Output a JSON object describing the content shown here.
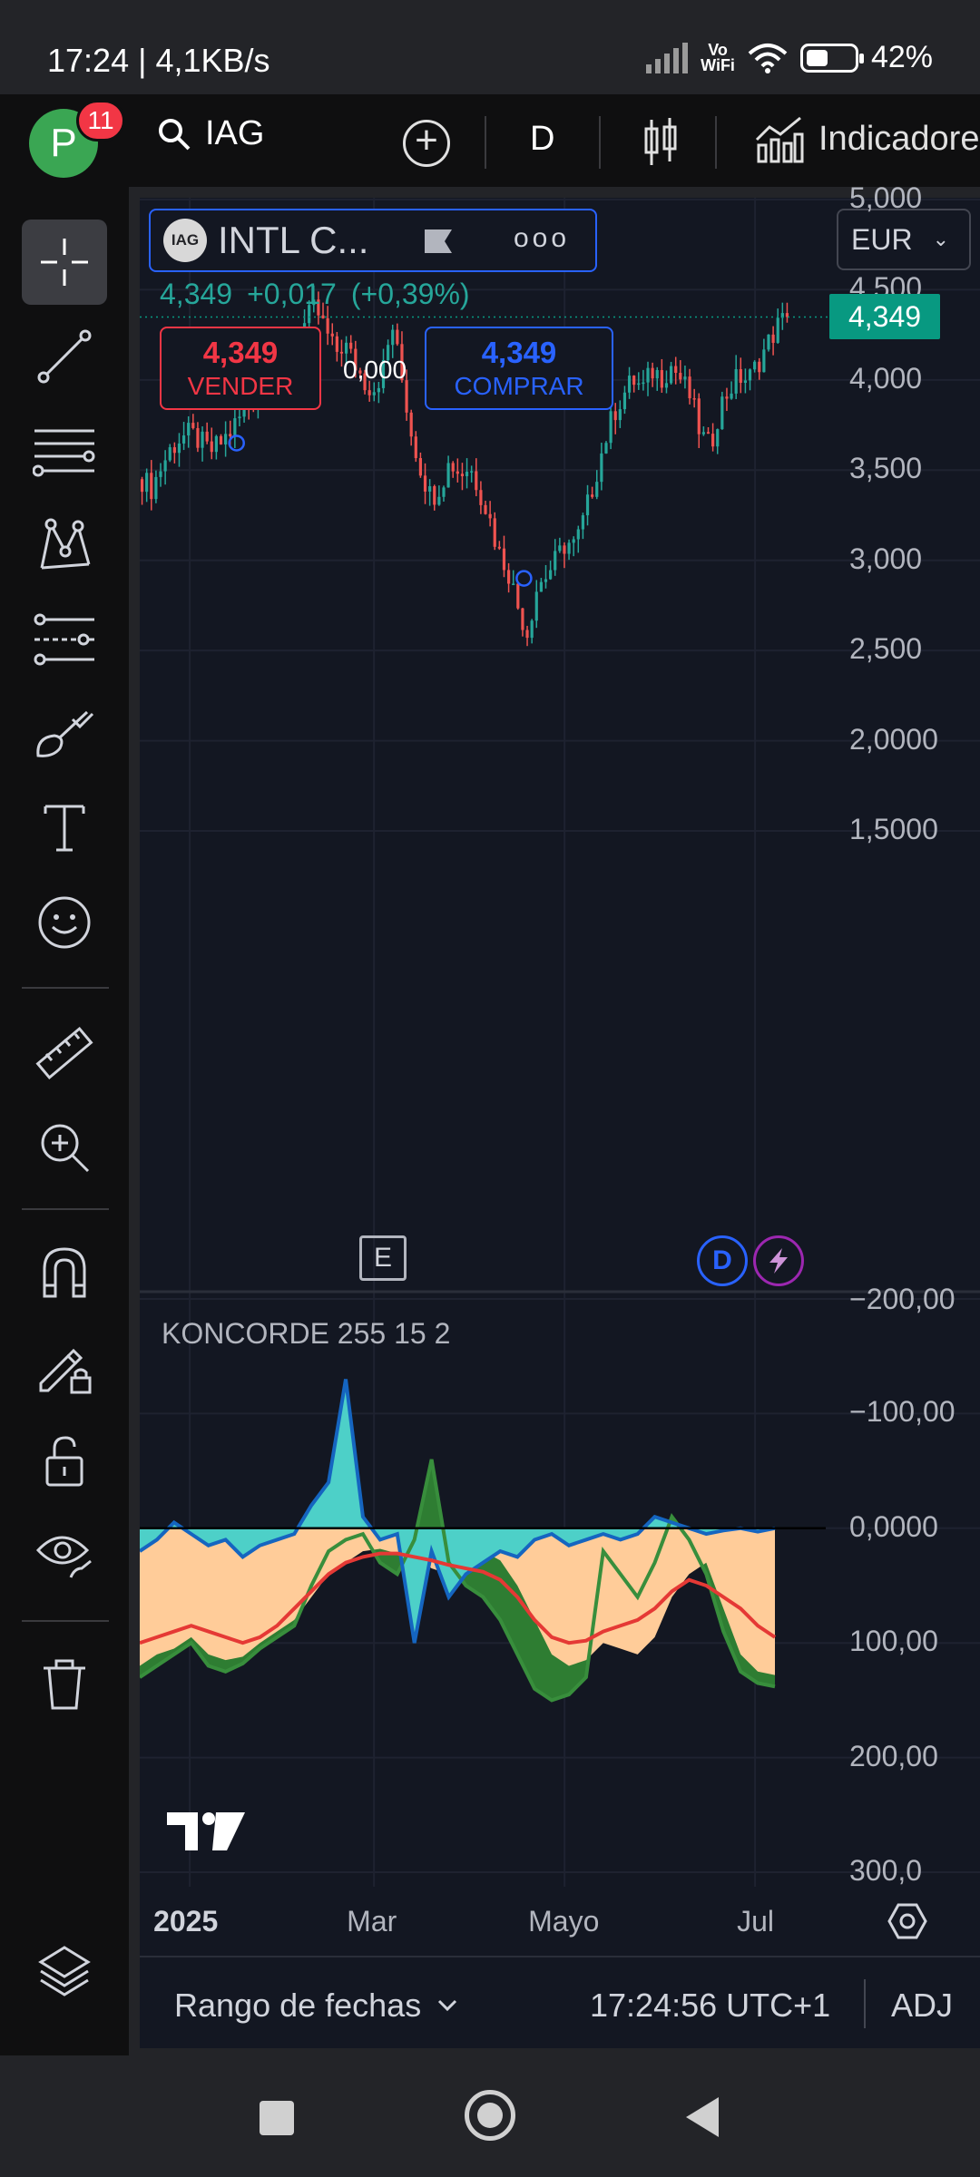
{
  "status_bar": {
    "time": "17:24 | 4,1KB/s",
    "network": "Vo\nWiFi",
    "battery": "42%"
  },
  "toolbar": {
    "notification_count": "11",
    "avatar_letter": "P",
    "symbol": "IAG",
    "interval": "D",
    "indicators_label": "Indicadores"
  },
  "symbol_box": {
    "logo_text": "IAG",
    "name": "INTL C...",
    "more": "ooo"
  },
  "currency": "EUR",
  "quote": {
    "last": "4,349",
    "change": "+0,017",
    "change_pct": "(+0,39%)",
    "sell_price": "4,349",
    "sell_label": "VENDER",
    "spread": "0,000",
    "buy_price": "4,349",
    "buy_label": "COMPRAR",
    "last_price_tag": "4,349"
  },
  "badges": {
    "earnings": "E",
    "dividends": "D"
  },
  "oscillator": {
    "title": "KONCORDE 255 15 2"
  },
  "chart_data": [
    {
      "type": "candlestick",
      "series_name": "IAG",
      "x_range": [
        "2024-12-16",
        "2025-07-12"
      ],
      "y_range": [
        1.5,
        5.0
      ],
      "y_ticks": [
        "5,000",
        "4,500",
        "4,000",
        "3,500",
        "3,000",
        "2,500",
        "2,0000",
        "1,5000"
      ],
      "x_ticks": [
        "2025",
        "Mar",
        "Mayo",
        "Jul"
      ],
      "last_price": 4.349,
      "closes": [
        3.45,
        3.4,
        3.52,
        3.62,
        3.68,
        3.7,
        3.66,
        3.6,
        3.64,
        3.7,
        3.78,
        3.85,
        3.92,
        3.98,
        4.05,
        4.12,
        4.2,
        4.32,
        4.4,
        4.28,
        4.15,
        4.2,
        4.1,
        4.0,
        3.95,
        4.05,
        4.3,
        4.0,
        3.7,
        3.5,
        3.35,
        3.42,
        3.55,
        3.48,
        3.52,
        3.4,
        3.25,
        3.05,
        2.95,
        2.75,
        2.6,
        2.85,
        2.92,
        3.0,
        3.1,
        3.08,
        3.25,
        3.45,
        3.65,
        3.82,
        3.92,
        4.0,
        3.95,
        4.05,
        4.02,
        4.08,
        4.0,
        3.9,
        3.7,
        3.62,
        3.85,
        3.95,
        4.02,
        4.0,
        4.1,
        4.2,
        4.3,
        4.349
      ]
    },
    {
      "type": "area",
      "series_name": "KONCORDE 255 15 2",
      "y_range": [
        -200,
        300
      ],
      "y_ticks": [
        "300,0",
        "200,00",
        "100,00",
        "0,0000",
        "−100,00",
        "−200,00"
      ],
      "series": [
        {
          "name": "marrón",
          "values": [
            120,
            110,
            105,
            95,
            110,
            115,
            112,
            100,
            90,
            80,
            60,
            40,
            30,
            20,
            18,
            22,
            25,
            35,
            40,
            30,
            20,
            28,
            50,
            80,
            110,
            120,
            115,
            100,
            105,
            110,
            95,
            60,
            40,
            30,
            70,
            110,
            125,
            128
          ]
        },
        {
          "name": "verde",
          "values": [
            130,
            120,
            110,
            100,
            120,
            125,
            118,
            105,
            95,
            85,
            50,
            20,
            10,
            5,
            30,
            40,
            10,
            -60,
            30,
            50,
            60,
            80,
            110,
            140,
            150,
            145,
            130,
            20,
            40,
            60,
            30,
            -10,
            10,
            40,
            90,
            125,
            135,
            138
          ]
        },
        {
          "name": "azul",
          "values": [
            20,
            10,
            -5,
            5,
            15,
            10,
            25,
            15,
            10,
            5,
            -20,
            -40,
            -130,
            -10,
            10,
            5,
            100,
            20,
            60,
            40,
            30,
            20,
            25,
            10,
            5,
            15,
            10,
            5,
            10,
            5,
            -10,
            -5,
            0,
            5,
            2,
            0,
            3,
            0
          ]
        },
        {
          "name": "media",
          "values": [
            100,
            95,
            90,
            85,
            90,
            95,
            100,
            95,
            85,
            70,
            55,
            40,
            30,
            25,
            22,
            22,
            25,
            28,
            32,
            35,
            38,
            45,
            60,
            80,
            95,
            100,
            98,
            90,
            85,
            80,
            70,
            55,
            45,
            50,
            60,
            70,
            85,
            95
          ]
        }
      ]
    }
  ],
  "time_axis": {
    "year": "2025",
    "mar": "Mar",
    "may": "Mayo",
    "jul": "Jul"
  },
  "bottom_bar": {
    "date_range_label": "Rango de fechas",
    "clock": "17:24:56 UTC+1",
    "adj": "ADJ"
  },
  "icons": {
    "search": "search-icon",
    "add": "plus-circle-icon",
    "candles": "candlestick-icon",
    "indicators": "indicators-icon",
    "crosshair": "crosshair-icon",
    "trend_line": "trend-line-icon",
    "fib": "fib-retracement-icon",
    "pattern": "pattern-icon",
    "prediction": "prediction-icon",
    "brush": "brush-icon",
    "text": "text-icon",
    "emoji": "emoji-icon",
    "ruler": "ruler-icon",
    "zoom": "zoom-in-icon",
    "magnet": "magnet-icon",
    "lock_draw": "pencil-lock-icon",
    "lock": "lock-icon",
    "visibility": "eye-icon",
    "trash": "trash-icon",
    "layers": "layers-icon",
    "settings": "settings-icon"
  }
}
